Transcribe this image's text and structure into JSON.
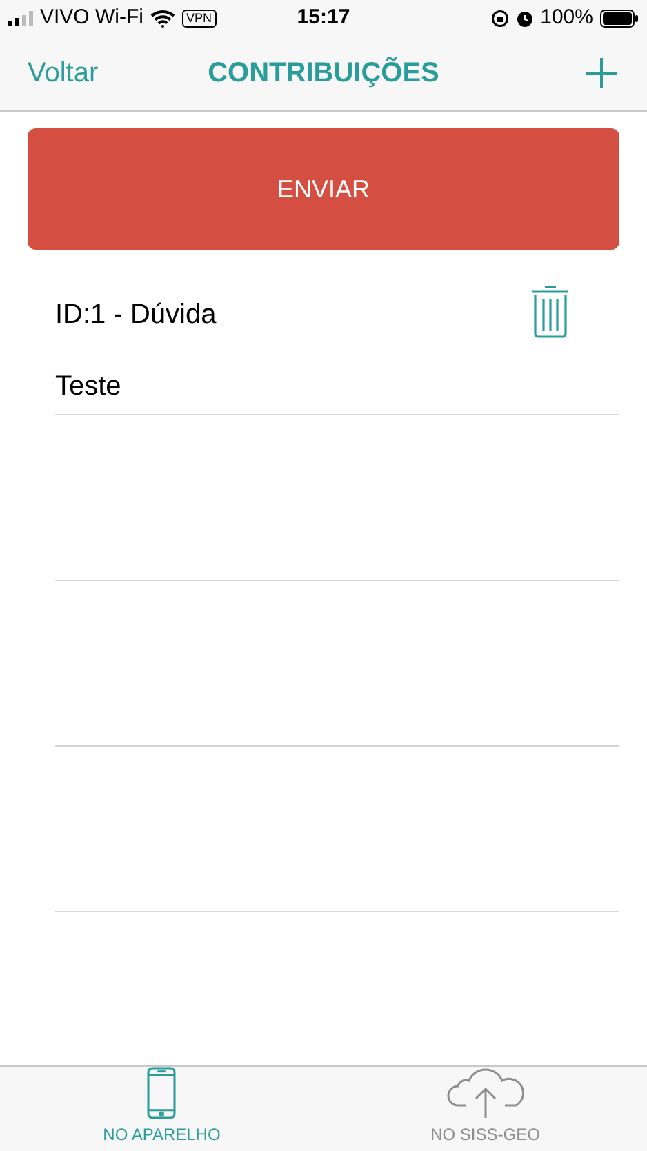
{
  "status_bar": {
    "carrier": "VIVO Wi-Fi",
    "vpn": "VPN",
    "time": "15:17",
    "battery": "100%"
  },
  "nav": {
    "back": "Voltar",
    "title": "CONTRIBUIÇÕES"
  },
  "send_button": "ENVIAR",
  "items": [
    {
      "title": "ID:1 - Dúvida",
      "subtitle": "Teste"
    }
  ],
  "tabs": [
    {
      "label": "NO APARELHO",
      "kind": "device",
      "selected": true
    },
    {
      "label": "NO SISS-GEO",
      "kind": "cloud",
      "selected": false
    }
  ]
}
